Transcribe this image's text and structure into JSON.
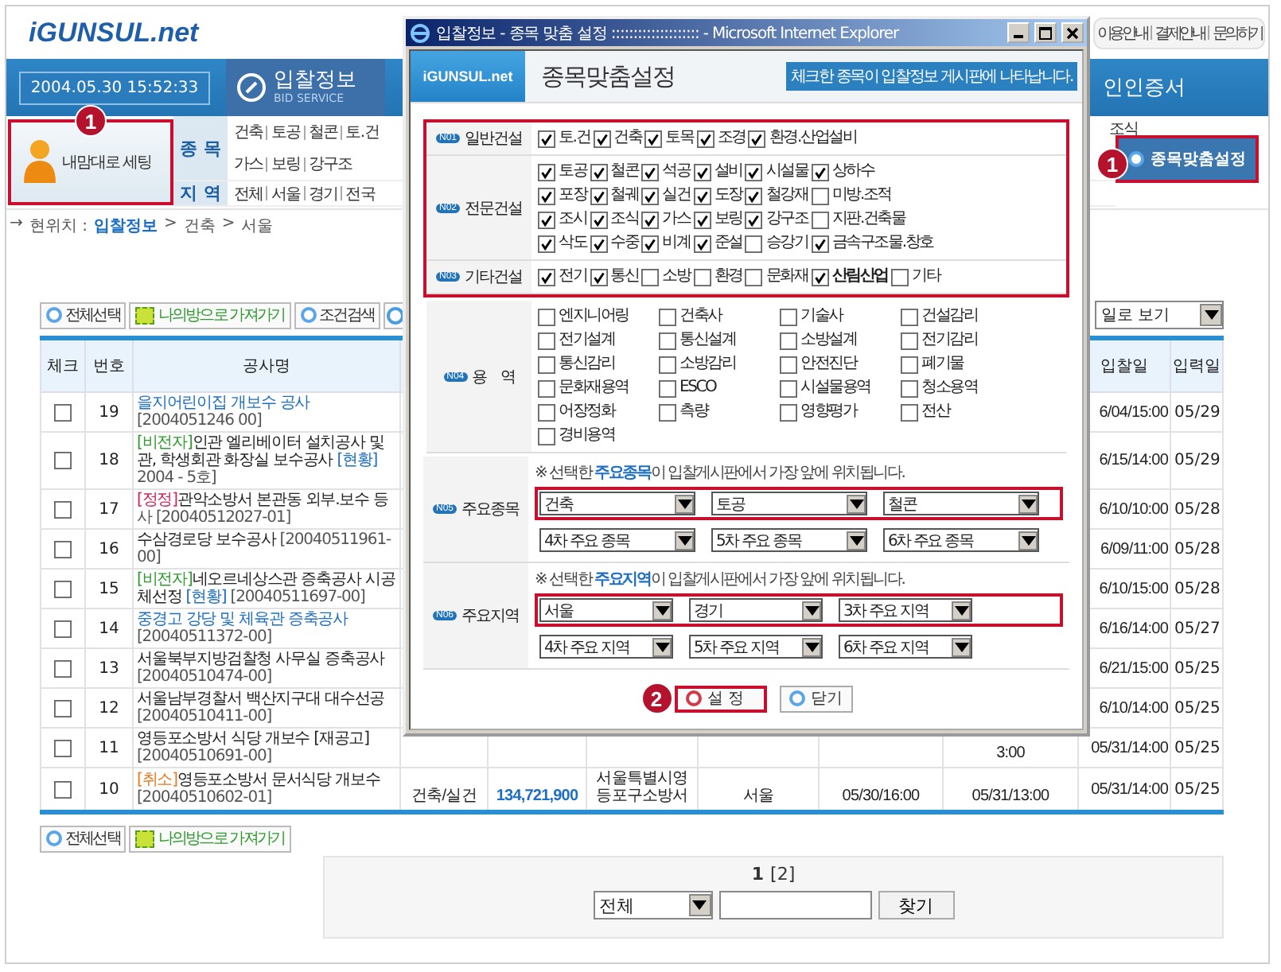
{
  "header": {
    "logo": "iGUNSUL.net",
    "links": [
      "이용안내",
      "결제안내",
      "문의하기"
    ]
  },
  "nav": {
    "clock": "2004.05.30 15:52:33",
    "tabs": [
      {
        "label": "입찰정보",
        "sublabel": "BID SERVICE",
        "selected": true
      },
      {
        "label": "인인증서",
        "selected": false
      }
    ]
  },
  "my_settings": {
    "label": "내맘대로 세팅",
    "callout": "1"
  },
  "filters": [
    {
      "label": "종 목",
      "lines": [
        [
          "건축",
          "토공",
          "철콘",
          "토.건"
        ],
        [
          "가스",
          "보링",
          "강구조"
        ]
      ],
      "right": "조식"
    },
    {
      "label": "지 역",
      "lines": [
        [
          "전체",
          "서울",
          "경기",
          "전국"
        ]
      ]
    }
  ],
  "custom_button": {
    "label": "종목맞춤설정",
    "callout": "1"
  },
  "breadcrumb": {
    "arrow": "→",
    "label": "현위치 :",
    "items": [
      "입찰정보",
      "건축",
      "서울"
    ],
    "separator": ">"
  },
  "toolbar": {
    "buttons": [
      {
        "kind": "plain",
        "label": "전체선택"
      },
      {
        "kind": "folder",
        "label": "나의방으로 가져가기"
      },
      {
        "kind": "plain",
        "label": "조건검색"
      },
      {
        "kind": "icon"
      }
    ],
    "view_select": "일로 보기"
  },
  "table": {
    "columns": [
      "체크",
      "번호",
      "공사명",
      "입찰일",
      "입력일"
    ],
    "rows": [
      {
        "checked": false,
        "no": "19",
        "title": [
          {
            "text": "을지어린이집 개보수 공사",
            "color": "#1c6fc4"
          },
          {
            "text": " [2004051246 00]",
            "color": "#555555"
          }
        ],
        "bid_date": "6/04/15:00",
        "input_date": "05/29"
      },
      {
        "checked": false,
        "no": "18",
        "title": [
          {
            "text": "[비전자]",
            "color": "#2e9b2e"
          },
          {
            "text": "인관 엘리베이터 설치공사 및",
            "color": "#222222"
          },
          {
            "text": "관, 학생회관 화장실 보수공사 ",
            "color": "#222222"
          },
          {
            "text": "[현황]",
            "color": "#1c6fc4"
          },
          {
            "text": " 2004 - 5호]",
            "color": "#555555"
          }
        ],
        "bid_date": "6/15/14:00",
        "input_date": "05/29"
      },
      {
        "checked": false,
        "no": "17",
        "title": [
          {
            "text": "[정정]",
            "color": "#d0245a"
          },
          {
            "text": "관악소방서 본관동 외부.보수 등 ",
            "color": "#222222"
          },
          {
            "text": "사 [20040512027-01]",
            "color": "#555555"
          }
        ],
        "bid_date": "6/10/10:00",
        "input_date": "05/28"
      },
      {
        "checked": false,
        "no": "16",
        "title": [
          {
            "text": "수삼경로당 보수공사",
            "color": "#222222"
          },
          {
            "text": " [20040511961-00]",
            "color": "#555555"
          }
        ],
        "bid_date": "6/09/11:00",
        "input_date": "05/28"
      },
      {
        "checked": false,
        "no": "15",
        "title": [
          {
            "text": "[비전자]",
            "color": "#2e9b2e"
          },
          {
            "text": "네오르네상스관 증축공사 시공 체선정 ",
            "color": "#222222"
          },
          {
            "text": "[현황]",
            "color": "#1c6fc4"
          },
          {
            "text": " [20040511697-00]",
            "color": "#555555"
          }
        ],
        "bid_date": "6/10/15:00",
        "input_date": "05/28"
      },
      {
        "checked": false,
        "no": "14",
        "title": [
          {
            "text": "중경고 강당 및 체육관 증축공사",
            "color": "#1c6fc4"
          },
          {
            "text": " [20040511372-00]",
            "color": "#555555"
          }
        ],
        "bid_date": "6/16/14:00",
        "input_date": "05/27"
      },
      {
        "checked": false,
        "no": "13",
        "title": [
          {
            "text": "서울북부지방검찰청 사무실 증축공사",
            "color": "#222222"
          },
          {
            "text": " [20040510474-00]",
            "color": "#555555"
          }
        ],
        "bid_date": "6/21/15:00",
        "input_date": "05/25"
      },
      {
        "checked": false,
        "no": "12",
        "title": [
          {
            "text": "서울남부경찰서 백산지구대 대수선공",
            "color": "#222222"
          },
          {
            "text": " [20040510411-00]",
            "color": "#555555"
          }
        ],
        "bid_date": "6/10/14:00",
        "input_date": "05/25"
      },
      {
        "checked": false,
        "no": "11",
        "title": [
          {
            "text": "영등포소방서 식당 개보수 [재공고]",
            "color": "#222222"
          },
          {
            "text": " [20040510691-00]",
            "color": "#555555"
          }
        ],
        "middle": {
          "column_9": "3:00"
        },
        "bid_date": "05/31/14:00",
        "input_date": "05/25"
      },
      {
        "checked": false,
        "no": "10",
        "title": [
          {
            "text": "[취소]",
            "color": "#e8771e"
          },
          {
            "text": "영등포소방서 문서식당 개보수",
            "color": "#222222"
          },
          {
            "text": " [20040510602-01]",
            "color": "#555555"
          }
        ],
        "middle": {
          "column_4": "건축/실건",
          "column_5": "134,721,900",
          "column_6": "서울특별시영등포구소방서",
          "column_7": "서울",
          "column_8": "05/30/16:00",
          "column_9": "05/31/13:00"
        },
        "bid_date": "05/31/14:00",
        "input_date": "05/25"
      }
    ]
  },
  "bottom_toolbar": [
    {
      "kind": "plain",
      "label": "전체선택"
    },
    {
      "kind": "folder",
      "label": "나의방으로 가져가기"
    }
  ],
  "pagination": [
    {
      "label": "1",
      "selected": true
    },
    {
      "label": "[2]",
      "selected": false
    }
  ],
  "search": {
    "scope": "전체",
    "button": "찾기"
  },
  "popup": {
    "title": "입찰정보 - 종목 맞춤 설정 :::::::::::::::::::: - Microsoft Internet Explorer",
    "logo": "iGUNSUL.net",
    "heading": "종목맞춤설정",
    "notice": "체크한 종목이 입찰정보 게시판에 나타납니다.",
    "groups": [
      {
        "highlighted": true,
        "sections": [
          {
            "code": "N01",
            "label": "일반건설",
            "kind": "grid",
            "items": [
              {
                "label": "토.건",
                "checked": true
              },
              {
                "label": "건축",
                "checked": true
              },
              {
                "label": "토목",
                "checked": true
              },
              {
                "label": "조경",
                "checked": true
              },
              {
                "label": "환경.산업설비",
                "checked": true
              }
            ]
          },
          {
            "code": "N02",
            "label": "전문건설",
            "kind": "grid",
            "items": [
              {
                "label": "토공",
                "checked": true
              },
              {
                "label": "철콘",
                "checked": true
              },
              {
                "label": "석공",
                "checked": true
              },
              {
                "label": "설비",
                "checked": true
              },
              {
                "label": "시설물",
                "checked": true
              },
              {
                "label": "상하수",
                "checked": true
              },
              {
                "label": "포장",
                "checked": true
              },
              {
                "label": "철궤",
                "checked": true
              },
              {
                "label": "실건",
                "checked": true
              },
              {
                "label": "도장",
                "checked": true
              },
              {
                "label": "철강재",
                "checked": true
              },
              {
                "label": "미방.조적",
                "checked": false
              },
              {
                "label": "조시",
                "checked": true
              },
              {
                "label": "조식",
                "checked": true
              },
              {
                "label": "가스",
                "checked": true
              },
              {
                "label": "보링",
                "checked": true
              },
              {
                "label": "강구조",
                "checked": true
              },
              {
                "label": "지판.건축물",
                "checked": false
              },
              {
                "label": "삭도",
                "checked": true
              },
              {
                "label": "수중",
                "checked": true
              },
              {
                "label": "비계",
                "checked": true
              },
              {
                "label": "준설",
                "checked": true
              },
              {
                "label": "승강기",
                "checked": false
              },
              {
                "label": "금속구조물.창호",
                "checked": true
              }
            ]
          },
          {
            "code": "N03",
            "label": "기타건설",
            "kind": "flow",
            "items": [
              {
                "label": "전기",
                "checked": true
              },
              {
                "label": "통신",
                "checked": true
              },
              {
                "label": "소방",
                "checked": false
              },
              {
                "label": "환경",
                "checked": false
              },
              {
                "label": "문화재",
                "checked": false
              },
              {
                "label": "산림산업",
                "checked": true
              },
              {
                "label": "기타",
                "checked": false
              }
            ]
          }
        ]
      },
      {
        "highlighted": false,
        "sections": [
          {
            "code": "N04",
            "label": "용    역",
            "kind": "wide",
            "items": [
              {
                "label": "엔지니어링",
                "checked": false
              },
              {
                "label": "건축사",
                "checked": false
              },
              {
                "label": "기술사",
                "checked": false
              },
              {
                "label": "건설감리",
                "checked": false
              },
              {
                "label": "전기설계",
                "checked": false
              },
              {
                "label": "통신설계",
                "checked": false
              },
              {
                "label": "소방설계",
                "checked": false
              },
              {
                "label": "전기감리",
                "checked": false
              },
              {
                "label": "통신감리",
                "checked": false
              },
              {
                "label": "소방감리",
                "checked": false
              },
              {
                "label": "안전진단",
                "checked": false
              },
              {
                "label": "폐기물",
                "checked": false
              },
              {
                "label": "문화재용역",
                "checked": false
              },
              {
                "label": "ESCO",
                "checked": false
              },
              {
                "label": "시설물용역",
                "checked": false
              },
              {
                "label": "청소용역",
                "checked": false
              },
              {
                "label": "어장정화",
                "checked": false
              },
              {
                "label": "측량",
                "checked": false
              },
              {
                "label": "영향평가",
                "checked": false
              },
              {
                "label": "전산",
                "checked": false
              },
              {
                "label": "경비용역",
                "checked": false
              }
            ]
          }
        ]
      }
    ],
    "selects": [
      {
        "code": "N05",
        "label": "주요종목",
        "note": "※ 선택한 **주요종목**이 입찰게시판에서 가장 앞에 위치됩니다.",
        "rows": [
          {
            "highlighted": true,
            "options": [
              "건축",
              "토공",
              "철콘"
            ]
          },
          {
            "highlighted": false,
            "options": [
              "4차 주요 종목",
              "5차 주요 종목",
              "6차 주요 종목"
            ]
          }
        ]
      },
      {
        "code": "N06",
        "label": "주요지역",
        "note": "※ 선택한 **주요지역**이 입찰게시판에서 가장 앞에 위치됩니다.",
        "rows": [
          {
            "highlighted": true,
            "options": [
              "서울",
              "경기",
              "3차 주요 지역"
            ]
          },
          {
            "highlighted": false,
            "options": [
              "4차 주요 지역",
              "5차 주요 지역",
              "6차 주요 지역"
            ]
          }
        ]
      }
    ],
    "buttons": [
      {
        "label": "설 정",
        "highlighted": true,
        "callout": "2"
      },
      {
        "label": "닫기",
        "highlighted": false
      }
    ]
  }
}
